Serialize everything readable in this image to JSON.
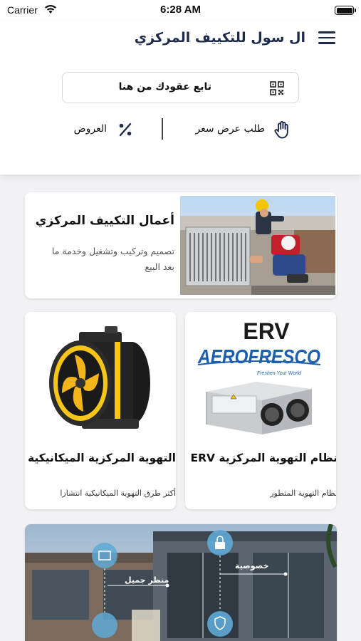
{
  "status_bar": {
    "carrier": "Carrier",
    "time": "6:28 AM"
  },
  "header": {
    "title": "ال سول للتكييف المركزي",
    "track_contracts": "تابع عقودك من هنا",
    "request_quote": "طلب عرض سعر",
    "offers": "العروض"
  },
  "cards": {
    "ac_works": {
      "title": "أعمال التكييف المركزي",
      "description": "تصميم وتركيب وتشغيل وخدمة ما بعد البيع"
    },
    "mechanical_ventilation": {
      "title": "التهوية المركزية الميكانيكية",
      "subtitle": "أكثر طرق التهوية الميكانيكية انتشارا"
    },
    "erv_system": {
      "title": "نظام التهوية المركزية ERV",
      "subtitle": "نظام التهوية المتطور",
      "image_label": "ERV",
      "brand": "AEROFRESCO",
      "tagline": "Freshen Your World"
    },
    "smart_home": {
      "privacy_label": "خصوصية",
      "view_label": "منظر جميل"
    }
  },
  "colors": {
    "brand_blue": "#1e2a4a",
    "fan_yellow": "#f5c518",
    "erv_blue": "#1b5fae"
  }
}
